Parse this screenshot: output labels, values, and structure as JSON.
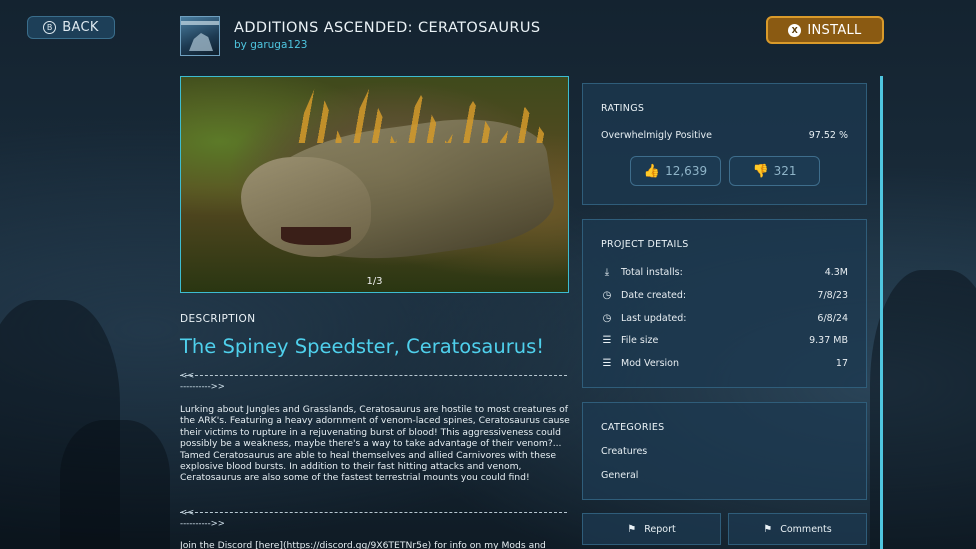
{
  "header": {
    "back_label": "BACK",
    "back_button_glyph": "B",
    "install_label": "INSTALL",
    "install_button_glyph": "X",
    "title": "ADDITIONS ASCENDED: CERATOSAURUS",
    "author": "by garuga123"
  },
  "gallery": {
    "counter": "1/3"
  },
  "description": {
    "heading": "DESCRIPTION",
    "title": "The Spiney Speedster, Ceratosaurus!",
    "divider_start": "<<",
    "divider_end": "---------->>",
    "body": "Lurking about Jungles and Grasslands, Ceratosaurus are hostile to most creatures of the ARK's. Featuring a heavy adornment of venom-laced spines, Ceratosaurus cause their victims to rupture in a rejuvenating burst of blood! This aggressiveness could possibly be a weakness, maybe there's a way to take advantage of their venom?...\nTamed Ceratosaurus are able to heal themselves and allied Carnivores with these explosive blood bursts. In addition to their fast hitting attacks and venom, Ceratosaurus are also some of the fastest terrestrial mounts you could find!",
    "discord": "Join the Discord [here](https://discord.gg/9X6TETNr5e) for info on my Mods and"
  },
  "ratings": {
    "heading": "RATINGS",
    "summary_label": "Overwhelmigly Positive",
    "percent": "97.52 %",
    "upvotes": "12,639",
    "downvotes": "321"
  },
  "project_details": {
    "heading": "PROJECT DETAILS",
    "rows": [
      {
        "label": "Total installs:",
        "value": "4.3M",
        "icon": "download-icon"
      },
      {
        "label": "Date created:",
        "value": "7/8/23",
        "icon": "clock-icon"
      },
      {
        "label": "Last updated:",
        "value": "6/8/24",
        "icon": "clock-icon"
      },
      {
        "label": "File size",
        "value": "9.37 MB",
        "icon": "storage-icon"
      },
      {
        "label": "Mod Version",
        "value": "17",
        "icon": "storage-icon"
      }
    ]
  },
  "categories": {
    "heading": "CATEGORIES",
    "items": [
      "Creatures",
      "General"
    ]
  },
  "actions": {
    "report_label": "Report",
    "comments_label": "Comments"
  }
}
